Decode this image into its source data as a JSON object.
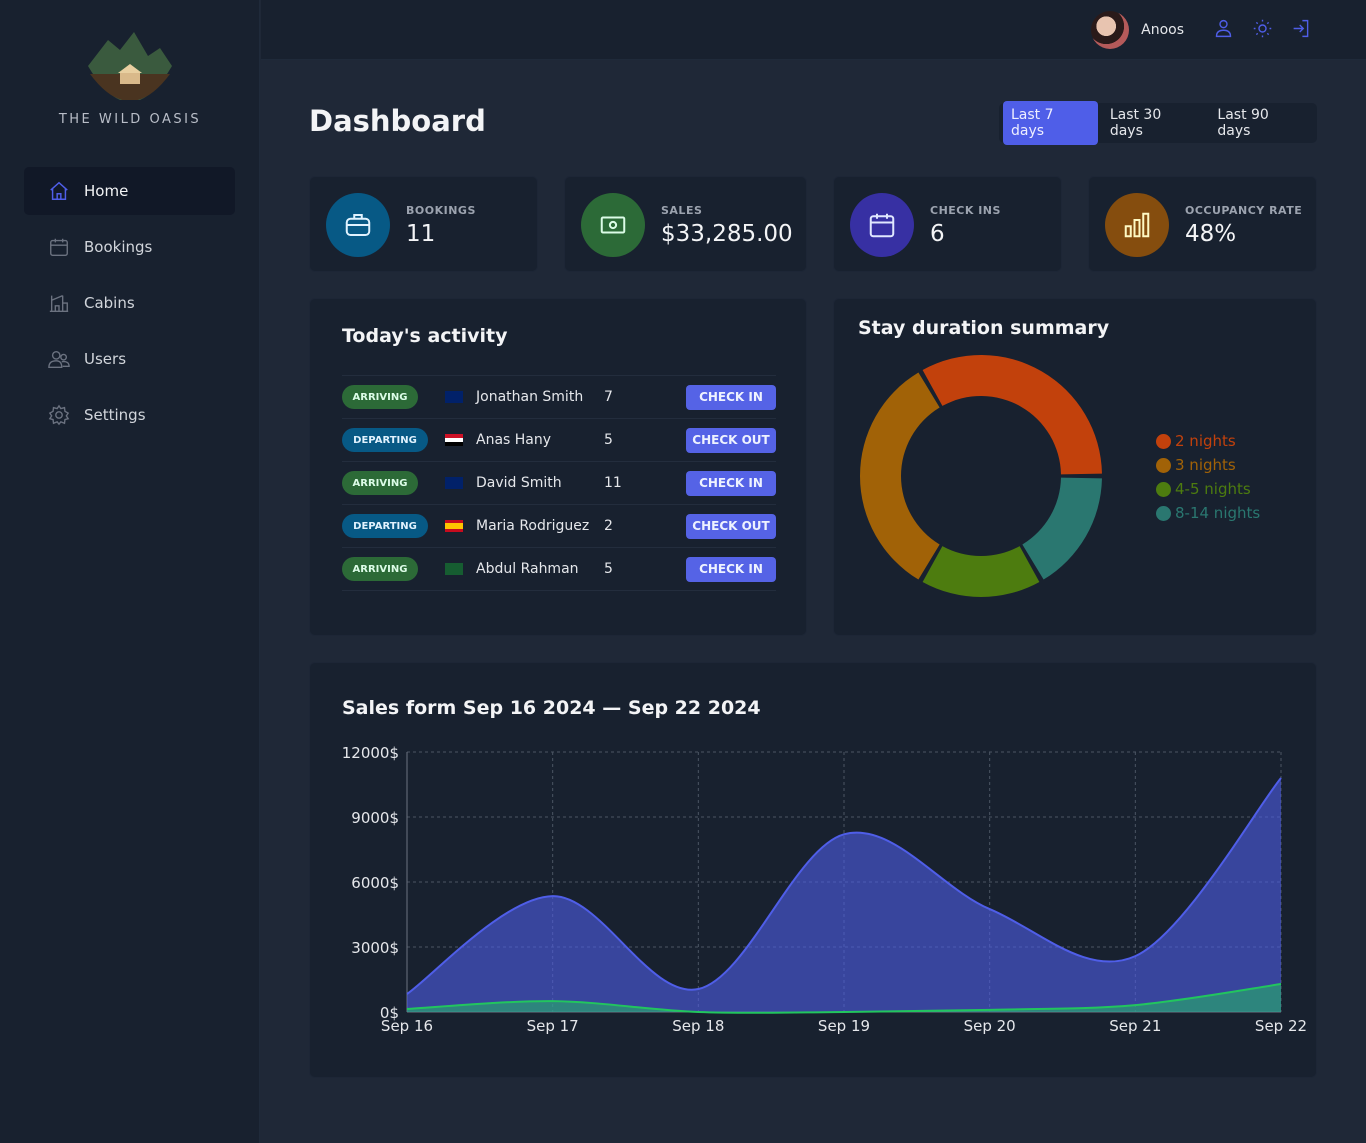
{
  "brand": {
    "name": "THE WILD OASIS"
  },
  "sidebar": {
    "items": [
      {
        "label": "Home",
        "icon": "home-icon",
        "active": true
      },
      {
        "label": "Bookings",
        "icon": "calendar-icon"
      },
      {
        "label": "Cabins",
        "icon": "cabin-icon"
      },
      {
        "label": "Users",
        "icon": "users-icon"
      },
      {
        "label": "Settings",
        "icon": "gear-icon"
      }
    ]
  },
  "header": {
    "user": "Anoos",
    "icons": [
      "user-icon",
      "sun-icon",
      "logout-icon"
    ],
    "accent": "#4f5ee8"
  },
  "page": {
    "title": "Dashboard",
    "filters": [
      "Last 7 days",
      "Last 30 days",
      "Last 90 days"
    ],
    "active_filter": "Last 7 days"
  },
  "stats": [
    {
      "label": "BOOKINGS",
      "value": "11",
      "icon": "briefcase-icon",
      "color": "#075985"
    },
    {
      "label": "SALES",
      "value": "$33,285.00",
      "icon": "banknote-icon",
      "color": "#2c6a37"
    },
    {
      "label": "CHECK INS",
      "value": "6",
      "icon": "calendar-icon",
      "color": "#3730a3"
    },
    {
      "label": "OCCUPANCY RATE",
      "value": "48%",
      "icon": "chart-bar-icon",
      "color": "#854d0e"
    }
  ],
  "activity": {
    "title": "Today's activity",
    "rows": [
      {
        "status": "ARRIVING",
        "country": "gb",
        "guest": "Jonathan Smith",
        "nights": "7",
        "action": "CHECK IN"
      },
      {
        "status": "DEPARTING",
        "country": "eg",
        "guest": "Anas Hany",
        "nights": "5",
        "action": "CHECK OUT"
      },
      {
        "status": "ARRIVING",
        "country": "au",
        "guest": "David Smith",
        "nights": "11",
        "action": "CHECK IN"
      },
      {
        "status": "DEPARTING",
        "country": "es",
        "guest": "Maria Rodriguez",
        "nights": "2",
        "action": "CHECK OUT"
      },
      {
        "status": "ARRIVING",
        "country": "sa",
        "guest": "Abdul Rahman",
        "nights": "5",
        "action": "CHECK IN"
      }
    ]
  },
  "duration": {
    "title": "Stay duration summary",
    "chart_data": {
      "type": "pie",
      "donut": true,
      "slices": [
        {
          "label": "2 nights",
          "value": 4,
          "color": "#c2410c"
        },
        {
          "label": "3 nights",
          "value": 4,
          "color": "#a16207"
        },
        {
          "label": "4-5 nights",
          "value": 2,
          "color": "#4d7c0f"
        },
        {
          "label": "8-14 nights",
          "value": 2,
          "color": "#2a7770"
        }
      ]
    }
  },
  "sales": {
    "title": "Sales form Sep 16 2024 — Sep 22 2024",
    "chart_data": {
      "type": "area",
      "categories": [
        "Sep 16",
        "Sep 17",
        "Sep 18",
        "Sep 19",
        "Sep 20",
        "Sep 21",
        "Sep 22"
      ],
      "yticks": [
        "0$",
        "3000$",
        "6000$",
        "9000$",
        "12000$"
      ],
      "ylim": [
        0,
        12000
      ],
      "grid": true,
      "series": [
        {
          "values": [
            830,
            5350,
            1060,
            8200,
            4750,
            2580,
            10800
          ],
          "color": "#4f5ee8"
        },
        {
          "values": [
            140,
            500,
            0,
            0,
            100,
            320,
            1290
          ],
          "color": "#22c55e"
        }
      ]
    }
  }
}
